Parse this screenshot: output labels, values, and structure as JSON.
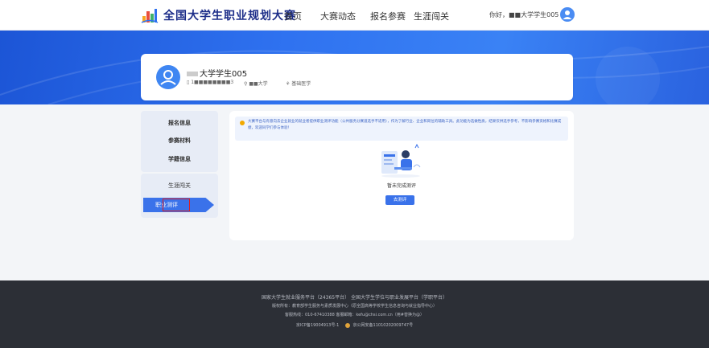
{
  "header": {
    "brand": "全国大学生职业规划大赛",
    "nav": [
      "首页",
      "大赛动态",
      "报名参赛",
      "生涯闯关"
    ],
    "greeting": "你好，■■大学学生005"
  },
  "profile": {
    "name": "大学学生005",
    "phone": "1■■■■■■■■3",
    "school": "■■大学",
    "major": "基础医学"
  },
  "menu": {
    "group1": [
      "报名信息",
      "参赛材料",
      "学籍信息"
    ],
    "group2_title": "生涯闯关",
    "active": "职业测评"
  },
  "main": {
    "notice": "大赛平台与有意向去企业就业的就业者提供职业测评功能（公共服务分赛道选手不适用），作为了解行业、企业和岗位的辅助工具。此功能为选做性质，结果仅供选手参考，不影响参赛资格和比赛成绩，欢迎同学们参与体验！",
    "empty_text": "暂未完成测评",
    "button": "去测评"
  },
  "footer": {
    "line1": "国家大学生就业服务平台（24365平台）   全国大学生学位与职业发展平台（学职平台）",
    "line2": "版权所有：教育部学生服务与素质发展中心（原全国高等学校学生信息咨询与就业指导中心）",
    "line3": "客服热线：010-67410388     客服邮箱：kefu@chsi.com.cn（用#替换为@）",
    "line4a": "京ICP备19004913号-1",
    "line4b": "京公网安备11010202009747号"
  },
  "colors": {
    "primary": "#3a72ea",
    "banner": "#2f72f0",
    "footer": "#2c2f36",
    "highlight": "#e02020"
  }
}
